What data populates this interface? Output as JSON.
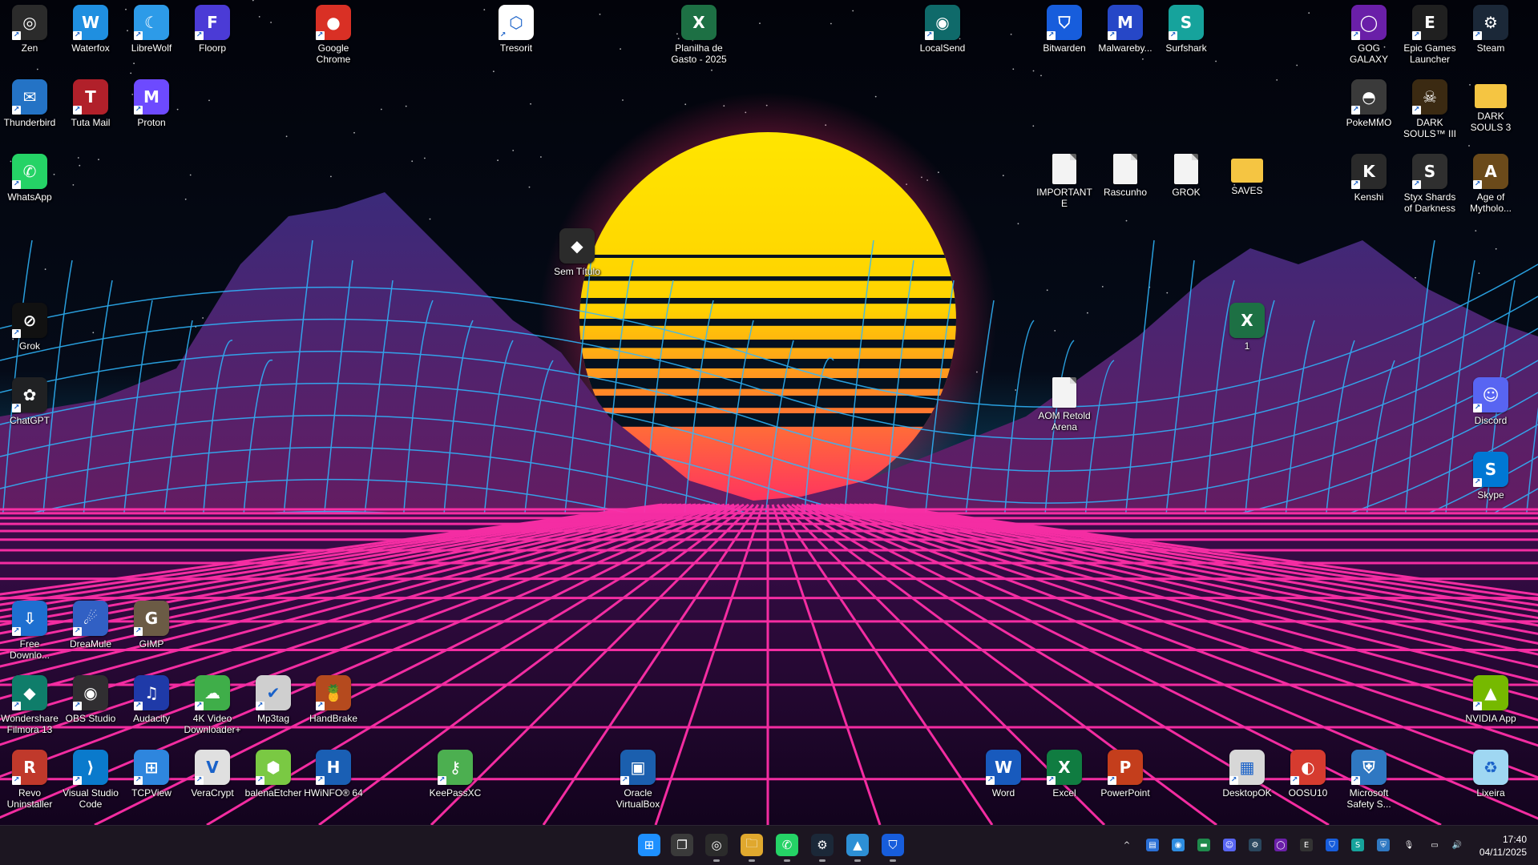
{
  "desktop": {
    "icons": [
      {
        "label": "Zen",
        "glyph": "◎",
        "color": "#2b2b2b",
        "icon": "zen-icon"
      },
      {
        "label": "Waterfox",
        "glyph": "W",
        "color": "#1f8fe0",
        "icon": "waterfox-icon"
      },
      {
        "label": "LibreWolf",
        "glyph": "☾",
        "color": "#2d9be8",
        "icon": "librewolf-icon"
      },
      {
        "label": "Floorp",
        "glyph": "F",
        "color": "#4b3bd6",
        "icon": "floorp-icon"
      },
      {
        "label": "Google Chrome",
        "glyph": "●",
        "color": "#d93025",
        "icon": "chrome-icon"
      },
      {
        "label": "Tresorit",
        "glyph": "⬡",
        "color": "#ffffff",
        "icon": "tresorit-icon"
      },
      {
        "label": "Planilha de Gasto - 2025",
        "glyph": "X",
        "color": "#1d7044",
        "icon": "excel-file-icon"
      },
      {
        "label": "LocalSend",
        "glyph": "◉",
        "color": "#0f6a6a",
        "icon": "localsend-icon"
      },
      {
        "label": "Bitwarden",
        "glyph": "⛉",
        "color": "#175ddc",
        "icon": "bitwarden-icon"
      },
      {
        "label": "Malwareby...",
        "glyph": "M",
        "color": "#2647c7",
        "icon": "malwarebytes-icon"
      },
      {
        "label": "Surfshark",
        "glyph": "S",
        "color": "#16a39c",
        "icon": "surfshark-icon"
      },
      {
        "label": "GOG GALAXY",
        "glyph": "◯",
        "color": "#6a1fa8",
        "icon": "gog-galaxy-icon"
      },
      {
        "label": "Epic Games Launcher",
        "glyph": "E",
        "color": "#202020",
        "icon": "epic-games-icon"
      },
      {
        "label": "Steam",
        "glyph": "⚙",
        "color": "#1b2838",
        "icon": "steam-icon"
      },
      {
        "label": "Thunderbird",
        "glyph": "✉",
        "color": "#2473c5",
        "icon": "thunderbird-icon"
      },
      {
        "label": "Tuta Mail",
        "glyph": "T",
        "color": "#b1202a",
        "icon": "tuta-mail-icon"
      },
      {
        "label": "Proton",
        "glyph": "M",
        "color": "#6d4aff",
        "icon": "proton-icon"
      },
      {
        "label": "PokeMMO",
        "glyph": "◓",
        "color": "#3a3a3a",
        "icon": "pokemmo-icon"
      },
      {
        "label": "DARK SOULS™ III",
        "glyph": "☠",
        "color": "#3b2a12",
        "icon": "dark-souls-3-icon"
      },
      {
        "label": "DARK SOULS 3",
        "glyph": "",
        "color": "#f5c542",
        "icon": "folder-icon"
      },
      {
        "label": "WhatsApp",
        "glyph": "✆",
        "color": "#25d366",
        "icon": "whatsapp-icon"
      },
      {
        "label": "IMPORTANTE",
        "glyph": "",
        "color": "#f3f3f3",
        "icon": "text-file-icon"
      },
      {
        "label": "Rascunho",
        "glyph": "",
        "color": "#f3f3f3",
        "icon": "text-file-icon"
      },
      {
        "label": "GROK",
        "glyph": "",
        "color": "#f3f3f3",
        "icon": "text-file-icon"
      },
      {
        "label": "SAVES",
        "glyph": "",
        "color": "#f5c542",
        "icon": "folder-icon"
      },
      {
        "label": "Kenshi",
        "glyph": "K",
        "color": "#2a2a2a",
        "icon": "kenshi-icon"
      },
      {
        "label": "Styx Shards of Darkness",
        "glyph": "S",
        "color": "#2f2f2f",
        "icon": "styx-icon"
      },
      {
        "label": "Age of Mytholo...",
        "glyph": "A",
        "color": "#6b4a1a",
        "icon": "age-of-mythology-icon"
      },
      {
        "label": "Sem Título",
        "glyph": "◆",
        "color": "#2b2b2b",
        "icon": "filmora-project-icon"
      },
      {
        "label": "1",
        "glyph": "X",
        "color": "#1d7044",
        "icon": "excel-file-icon"
      },
      {
        "label": "Grok",
        "glyph": "⊘",
        "color": "#111111",
        "icon": "grok-icon"
      },
      {
        "label": "ChatGPT",
        "glyph": "✿",
        "color": "#202123",
        "icon": "chatgpt-icon"
      },
      {
        "label": "AOM Retold Arena",
        "glyph": "",
        "color": "#f3f3f3",
        "icon": "text-file-icon"
      },
      {
        "label": "Discord",
        "glyph": "☺",
        "color": "#5865f2",
        "icon": "discord-icon"
      },
      {
        "label": "Skype",
        "glyph": "S",
        "color": "#0078d4",
        "icon": "skype-icon"
      },
      {
        "label": "Free Downlo...",
        "glyph": "⇩",
        "color": "#1e6fd0",
        "icon": "free-download-manager-icon"
      },
      {
        "label": "DreaMule",
        "glyph": "☄",
        "color": "#3160c4",
        "icon": "dreamule-icon"
      },
      {
        "label": "GIMP",
        "glyph": "G",
        "color": "#6b5b45",
        "icon": "gimp-icon"
      },
      {
        "label": "Wondershare Filmora 13",
        "glyph": "◆",
        "color": "#0f7d6a",
        "icon": "filmora-icon"
      },
      {
        "label": "OBS Studio",
        "glyph": "◉",
        "color": "#302e31",
        "icon": "obs-studio-icon"
      },
      {
        "label": "Audacity",
        "glyph": "♫",
        "color": "#1f3aa8",
        "icon": "audacity-icon"
      },
      {
        "label": "4K Video Downloader+",
        "glyph": "☁",
        "color": "#3fae49",
        "icon": "4k-video-downloader-icon"
      },
      {
        "label": "Mp3tag",
        "glyph": "✔",
        "color": "#cfcfcf",
        "icon": "mp3tag-icon"
      },
      {
        "label": "HandBrake",
        "glyph": "🍍",
        "color": "#b54a1e",
        "icon": "handbrake-icon"
      },
      {
        "label": "NVIDIA App",
        "glyph": "▲",
        "color": "#76b900",
        "icon": "nvidia-app-icon"
      },
      {
        "label": "Revo Uninstaller",
        "glyph": "R",
        "color": "#c0392b",
        "icon": "revo-uninstaller-icon"
      },
      {
        "label": "Visual Studio Code",
        "glyph": "⟩",
        "color": "#0a7acc",
        "icon": "vscode-icon"
      },
      {
        "label": "TCPView",
        "glyph": "⊞",
        "color": "#2e86de",
        "icon": "tcpview-icon"
      },
      {
        "label": "VeraCrypt",
        "glyph": "V",
        "color": "#e0e0e0",
        "icon": "veracrypt-icon"
      },
      {
        "label": "balenaEtcher",
        "glyph": "⬢",
        "color": "#7ac943",
        "icon": "balena-etcher-icon"
      },
      {
        "label": "HWiNFO® 64",
        "glyph": "H",
        "color": "#1a5fb4",
        "icon": "hwinfo-icon"
      },
      {
        "label": "KeePassXC",
        "glyph": "⚷",
        "color": "#4caf50",
        "icon": "keepassxc-icon"
      },
      {
        "label": "Oracle VirtualBox",
        "glyph": "▣",
        "color": "#1b5fae",
        "icon": "virtualbox-icon"
      },
      {
        "label": "Word",
        "glyph": "W",
        "color": "#185abd",
        "icon": "word-icon"
      },
      {
        "label": "Excel",
        "glyph": "X",
        "color": "#107c41",
        "icon": "excel-icon"
      },
      {
        "label": "PowerPoint",
        "glyph": "P",
        "color": "#c43e1c",
        "icon": "powerpoint-icon"
      },
      {
        "label": "DesktopOK",
        "glyph": "▦",
        "color": "#d7d7d7",
        "icon": "desktopok-icon"
      },
      {
        "label": "OOSU10",
        "glyph": "◐",
        "color": "#d63b2f",
        "icon": "oosu10-icon"
      },
      {
        "label": "Microsoft Safety S...",
        "glyph": "⛨",
        "color": "#2f78c2",
        "icon": "safety-scanner-icon"
      },
      {
        "label": "Lixeira",
        "glyph": "♻",
        "color": "#9fd7f2",
        "icon": "recycle-bin-icon"
      }
    ]
  },
  "taskbar": {
    "apps": [
      {
        "name": "start-button",
        "glyph": "⊞",
        "color": "#1e90ff",
        "running": false
      },
      {
        "name": "task-view-button",
        "glyph": "❐",
        "color": "#3a3a3a",
        "running": false
      },
      {
        "name": "zen-browser",
        "glyph": "◎",
        "color": "#2b2b2b",
        "running": true
      },
      {
        "name": "file-explorer",
        "glyph": "🗀",
        "color": "#e0a82e",
        "running": true
      },
      {
        "name": "whatsapp",
        "glyph": "✆",
        "color": "#25d366",
        "running": true
      },
      {
        "name": "steam",
        "glyph": "⚙",
        "color": "#1b2838",
        "running": true
      },
      {
        "name": "image-app",
        "glyph": "▲",
        "color": "#2d8fd5",
        "running": true
      },
      {
        "name": "bitwarden",
        "glyph": "⛉",
        "color": "#175ddc",
        "running": true
      }
    ],
    "tray": [
      {
        "name": "show-hidden-icons",
        "glyph": "^",
        "color": "transparent"
      },
      {
        "name": "tray-app-1",
        "glyph": "▤",
        "color": "#2a6fd6"
      },
      {
        "name": "tray-app-2",
        "glyph": "◉",
        "color": "#2d8ce0"
      },
      {
        "name": "tray-app-3",
        "glyph": "▬",
        "color": "#1f8a4c"
      },
      {
        "name": "discord",
        "glyph": "☺",
        "color": "#5865f2"
      },
      {
        "name": "steam",
        "glyph": "⚙",
        "color": "#2a475e"
      },
      {
        "name": "gog-galaxy",
        "glyph": "◯",
        "color": "#6a1fa8"
      },
      {
        "name": "epic-games",
        "glyph": "E",
        "color": "#333333"
      },
      {
        "name": "bitwarden",
        "glyph": "⛉",
        "color": "#175ddc"
      },
      {
        "name": "surfshark",
        "glyph": "S",
        "color": "#16a39c"
      },
      {
        "name": "security",
        "glyph": "⛨",
        "color": "#2f78c2"
      },
      {
        "name": "microphone",
        "glyph": "🎙",
        "color": "transparent"
      },
      {
        "name": "network",
        "glyph": "▭",
        "color": "transparent"
      },
      {
        "name": "volume",
        "glyph": "🔊",
        "color": "transparent"
      }
    ],
    "clock": {
      "time": "17:40",
      "date": "04/11/2025"
    }
  }
}
